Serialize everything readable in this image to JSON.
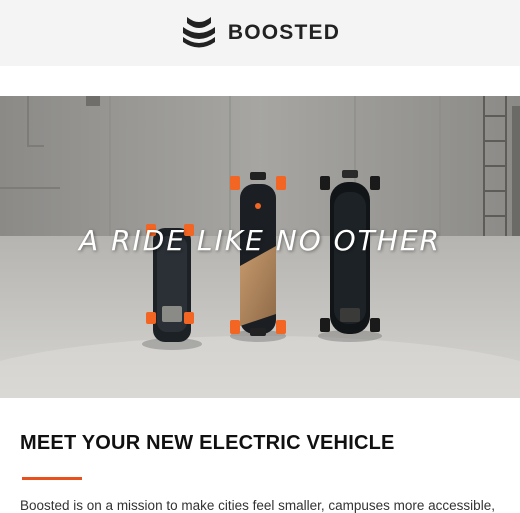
{
  "header": {
    "brand": "BOOSTED",
    "logo_icon": "boosted-logo-icon"
  },
  "hero": {
    "headline": "A RIDE LIKE NO OTHER",
    "image_description_icon": "skateboards-image"
  },
  "section": {
    "title": "MEET YOUR NEW ELECTRIC VEHICLE",
    "body": "Boosted is on a mission to make cities feel smaller, campuses more accessible,"
  },
  "colors": {
    "accent": "#e8501d",
    "wheel_orange": "#f26522",
    "header_bg": "#f4f4f4"
  }
}
